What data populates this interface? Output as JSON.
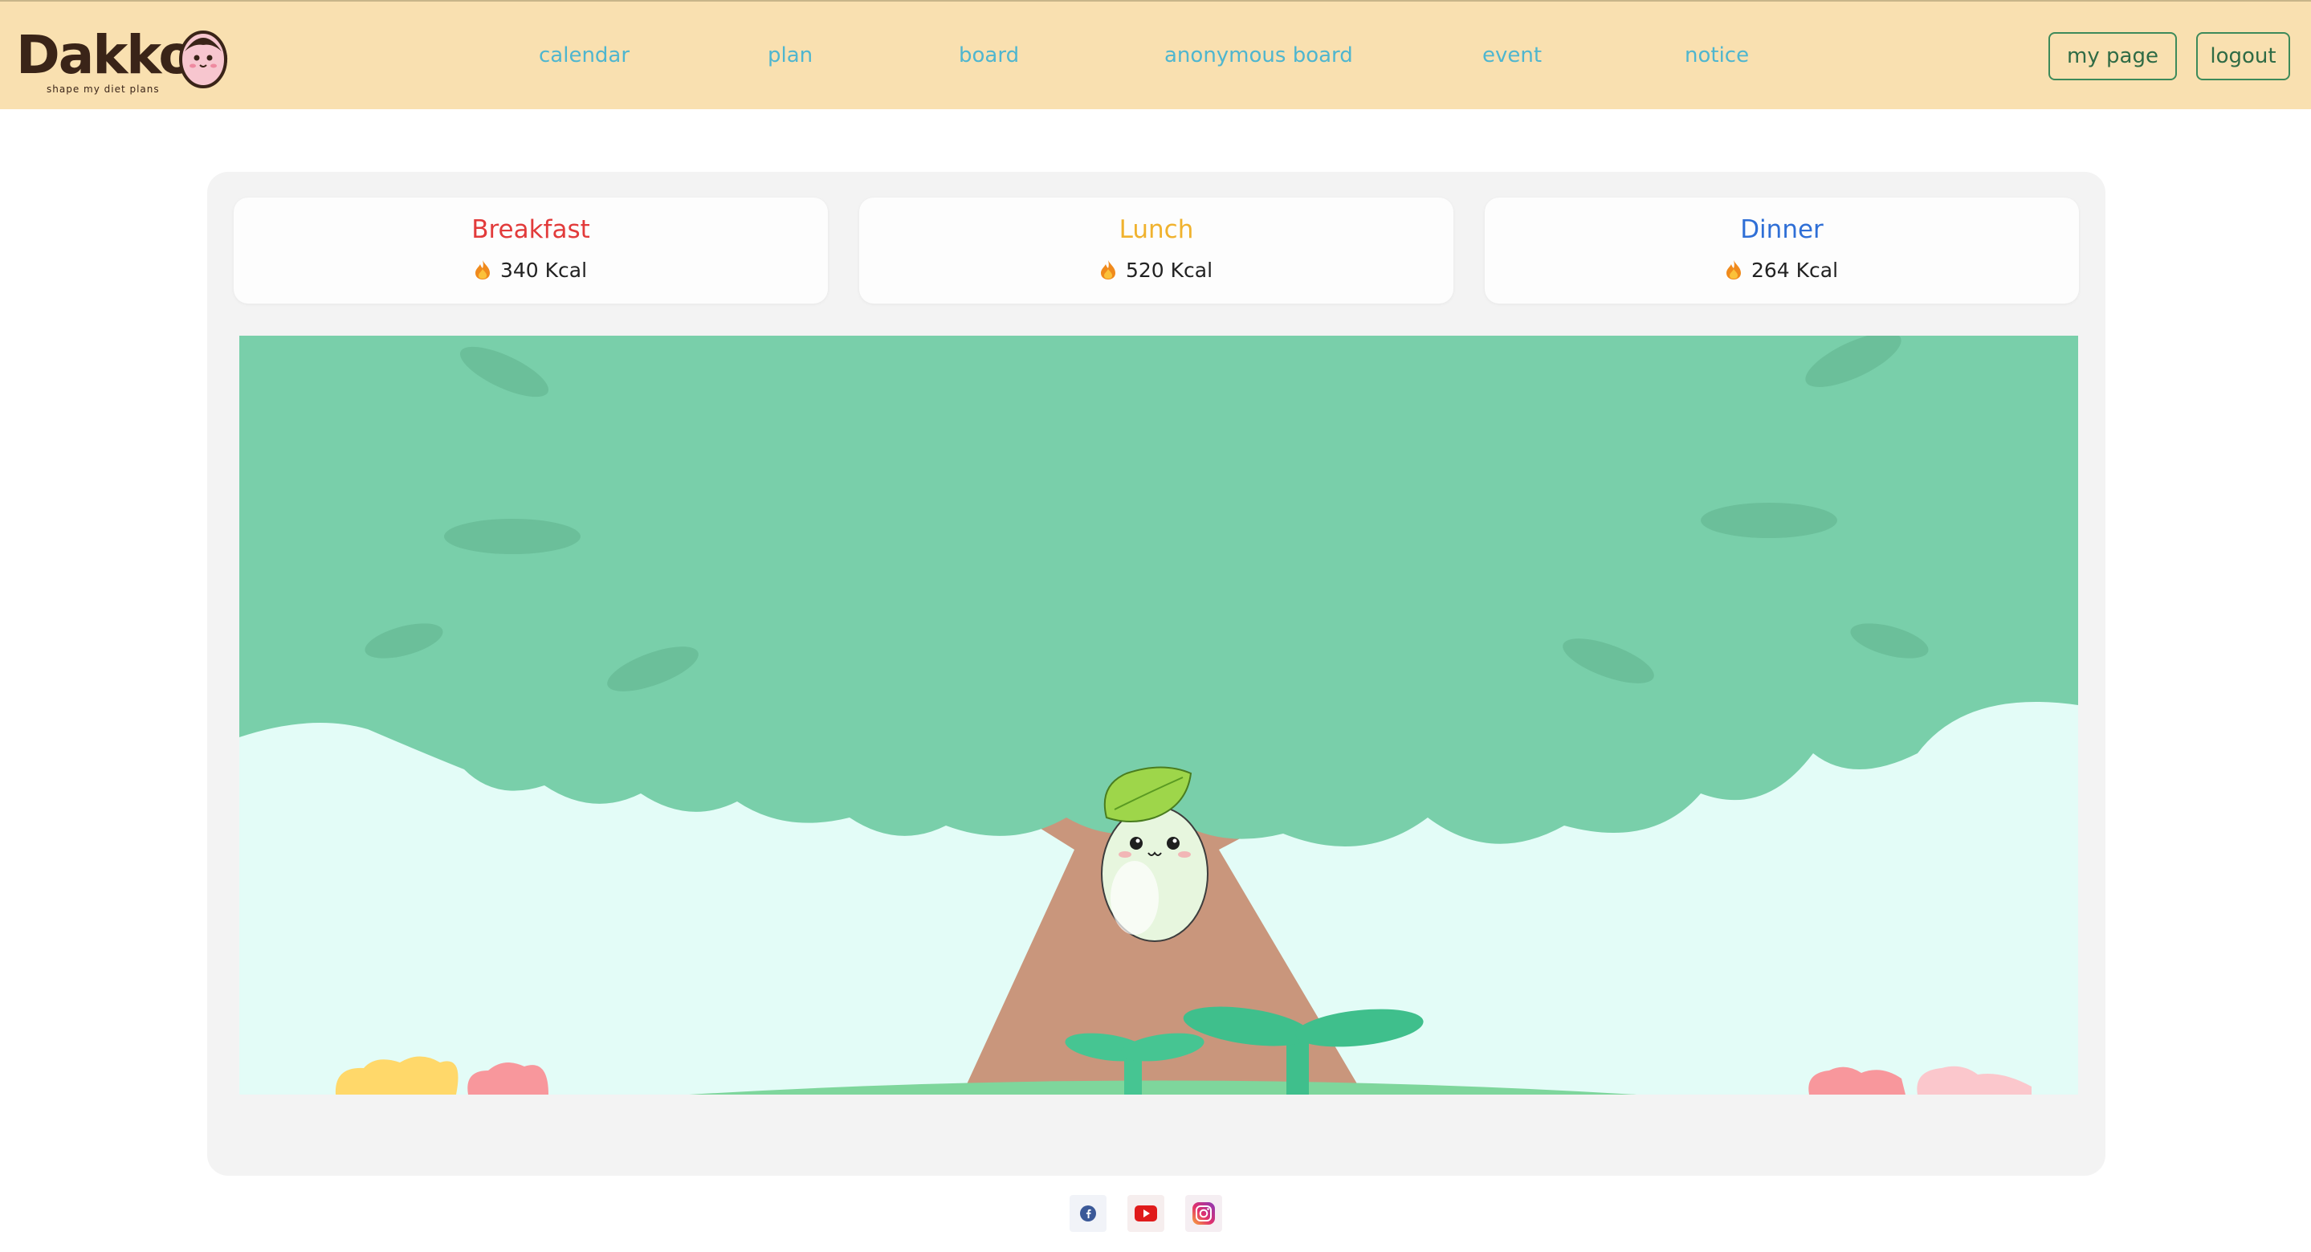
{
  "brand": {
    "name": "Dakkoo",
    "tagline": "shape my diet plans"
  },
  "nav": {
    "items": [
      {
        "label": "calendar"
      },
      {
        "label": "plan"
      },
      {
        "label": "board"
      },
      {
        "label": "anonymous board"
      },
      {
        "label": "event"
      },
      {
        "label": "notice"
      }
    ]
  },
  "header_buttons": {
    "my_page": "my page",
    "logout": "logout"
  },
  "meals": [
    {
      "name": "Breakfast",
      "kcal": "340 Kcal",
      "color": "#e23b3b"
    },
    {
      "name": "Lunch",
      "kcal": "520 Kcal",
      "color": "#f0b22e"
    },
    {
      "name": "Dinner",
      "kcal": "264 Kcal",
      "color": "#2f6fd6"
    }
  ],
  "icons": {
    "flame": "fire-icon",
    "social": [
      "facebook-icon",
      "youtube-icon",
      "instagram-icon"
    ]
  },
  "colors": {
    "header_bg": "#f9e0b0",
    "nav_link": "#4fb6cf",
    "button_border": "#3d8a5a",
    "tree_canopy": "#79cfaa",
    "sky": "#e3fcf7",
    "trunk": "#c9967c"
  }
}
